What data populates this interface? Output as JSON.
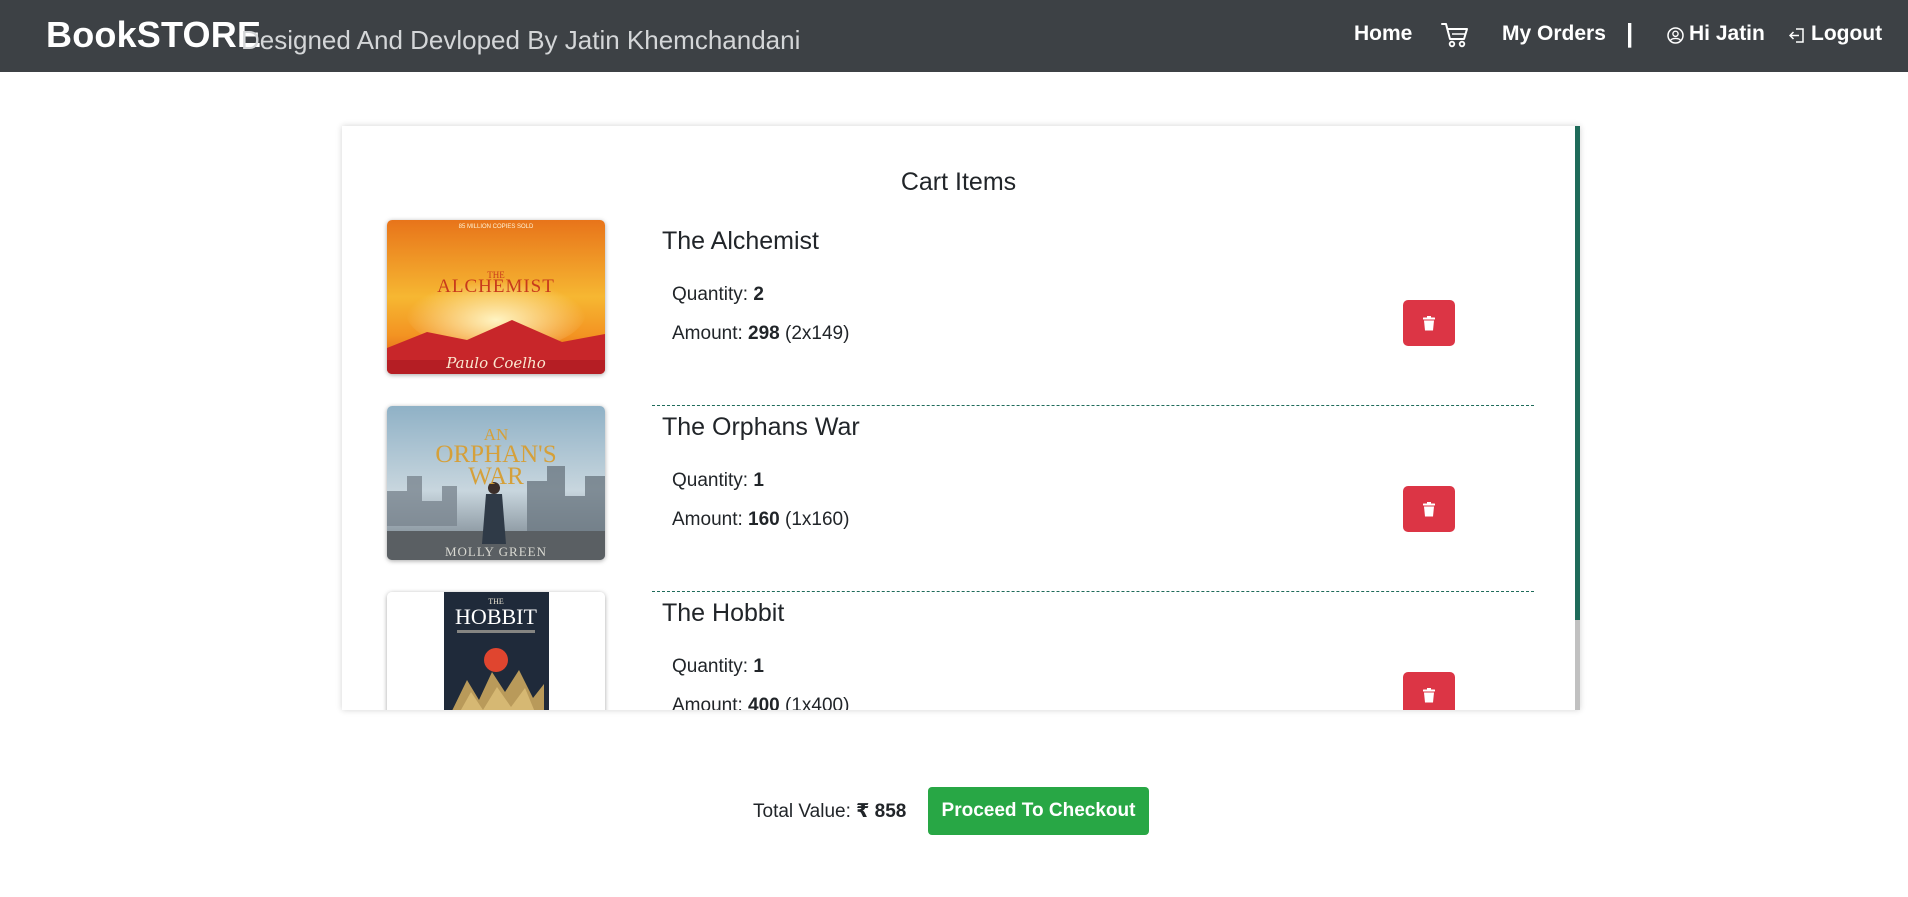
{
  "navbar": {
    "brand": "BookSTORE",
    "tagline": "Designed And Devloped By Jatin Khemchandani",
    "home": "Home",
    "cart_icon": "cart-icon",
    "my_orders": "My Orders",
    "separator": "|",
    "user_greeting": "Hi Jatin",
    "user_icon": "user-circle-icon",
    "logout": "Logout",
    "logout_icon": "logout-icon"
  },
  "cart": {
    "title": "Cart Items",
    "quantity_label": "Quantity: ",
    "amount_label": "Amount: ",
    "items": [
      {
        "title": "The Alchemist",
        "quantity": "2",
        "amount": "298",
        "breakdown": " (2x149)",
        "cover_top": "85 MILLION COPIES SOLD",
        "cover_title_small": "THE",
        "cover_title": "ALCHEMIST",
        "cover_author": "Paulo Coelho"
      },
      {
        "title": "The Orphans War",
        "quantity": "1",
        "amount": "160",
        "breakdown": " (1x160)",
        "cover_title_small": "AN",
        "cover_title": "ORPHAN'S",
        "cover_title2": "WAR",
        "cover_author": "MOLLY GREEN"
      },
      {
        "title": "The Hobbit",
        "quantity": "1",
        "amount": "400",
        "breakdown": " (1x400)",
        "cover_title_small": "THE",
        "cover_title": "HOBBIT"
      }
    ]
  },
  "footer": {
    "total_label": "Total Value: ",
    "total_value": "₹ 858",
    "checkout_label": "Proceed To Checkout"
  },
  "colors": {
    "navbar_bg": "#3d4145",
    "delete": "#dc3545",
    "checkout": "#28a745",
    "accent": "#1f6b5a"
  }
}
